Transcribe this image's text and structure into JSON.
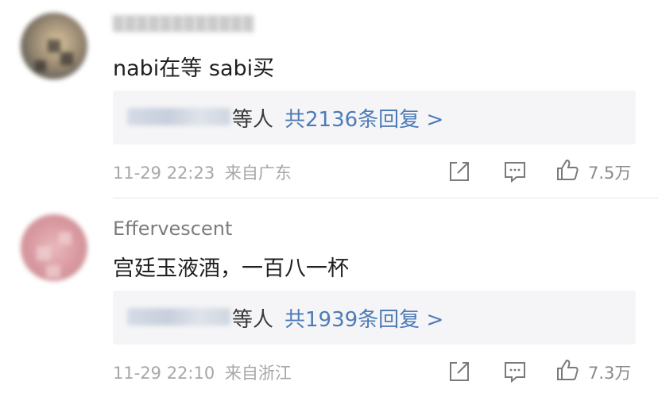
{
  "comments": [
    {
      "username": "▒▒▒▒▒▒▒▒▒▒▒▒",
      "text": "nabi在等 sabi买",
      "replies_who": "等人",
      "replies_count": "共2136条回复 >",
      "date": "11-29 22:23",
      "location": "来自广东",
      "likes": "7.5万"
    },
    {
      "username": "Effervescent",
      "text": "宫廷玉液酒，一百八一杯",
      "replies_who": "等人",
      "replies_count": "共1939条回复 >",
      "date": "11-29 22:10",
      "location": "来自浙江",
      "likes": "7.3万"
    }
  ],
  "icons": [
    "share-icon",
    "comment-icon",
    "like-icon"
  ],
  "colors": {
    "accent": "#4d7bb6",
    "meta": "#a7a7a7",
    "reply_bg": "#f5f5f7"
  }
}
